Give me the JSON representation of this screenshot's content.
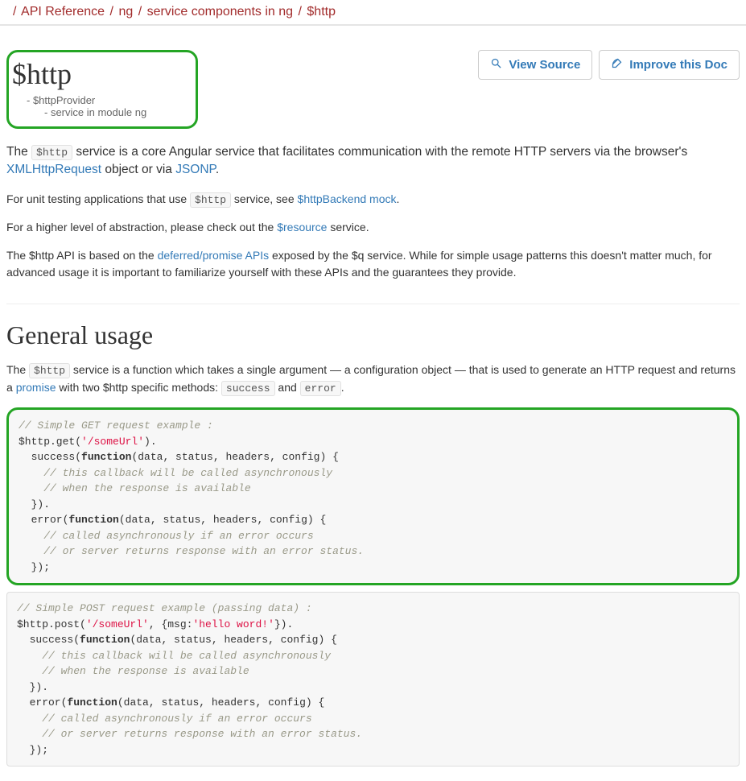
{
  "breadcrumb": {
    "items": [
      "API Reference",
      "ng",
      "service components in ng",
      "$http"
    ]
  },
  "header": {
    "title": "$http",
    "sub1": "- $httpProvider",
    "sub2": "- service in module ng",
    "btn_source": "View Source",
    "btn_improve": "Improve this Doc"
  },
  "intro": {
    "p1_a": "The ",
    "p1_code": "$http",
    "p1_b": " service is a core Angular service that facilitates communication with the remote HTTP servers via the browser's ",
    "p1_link1": "XMLHttpRequest",
    "p1_c": " object or via ",
    "p1_link2": "JSONP",
    "p1_d": ".",
    "p2_a": "For unit testing applications that use ",
    "p2_code": "$http",
    "p2_b": " service, see ",
    "p2_link": "$httpBackend mock",
    "p2_c": ".",
    "p3_a": "For a higher level of abstraction, please check out the ",
    "p3_link": "$resource",
    "p3_b": " service.",
    "p4_a": "The $http API is based on the ",
    "p4_link": "deferred/promise APIs",
    "p4_b": " exposed by the $q service. While for simple usage patterns this doesn't matter much, for advanced usage it is important to familiarize yourself with these APIs and the guarantees they provide."
  },
  "usage": {
    "heading": "General usage",
    "p1_a": "The ",
    "p1_code": "$http",
    "p1_b": " service is a function which takes a single argument — a configuration object — that is used to generate an HTTP request and returns a ",
    "p1_link": "promise",
    "p1_c": " with two $http specific methods: ",
    "p1_code2": "success",
    "p1_d": " and ",
    "p1_code3": "error",
    "p1_e": "."
  },
  "code1": {
    "c1": "// Simple GET request example :",
    "l2a": "$http.get(",
    "l2s": "'/someUrl'",
    "l2b": ").",
    "l3a": "  success(",
    "l3k": "function",
    "l3b": "(data, status, headers, config) {",
    "c4": "    // this callback will be called asynchronously",
    "c5": "    // when the response is available",
    "l6": "  }).",
    "l7a": "  error(",
    "l7k": "function",
    "l7b": "(data, status, headers, config) {",
    "c8": "    // called asynchronously if an error occurs",
    "c9": "    // or server returns response with an error status.",
    "l10": "  });"
  },
  "code2": {
    "c1": "// Simple POST request example (passing data) :",
    "l2a": "$http.post(",
    "l2s1": "'/someUrl'",
    "l2b": ", {msg:",
    "l2s2": "'hello word!'",
    "l2c": "}).",
    "l3a": "  success(",
    "l3k": "function",
    "l3b": "(data, status, headers, config) {",
    "c4": "    // this callback will be called asynchronously",
    "c5": "    // when the response is available",
    "l6": "  }).",
    "l7a": "  error(",
    "l7k": "function",
    "l7b": "(data, status, headers, config) {",
    "c8": "    // called asynchronously if an error occurs",
    "c9": "    // or server returns response with an error status.",
    "l10": "  });"
  }
}
